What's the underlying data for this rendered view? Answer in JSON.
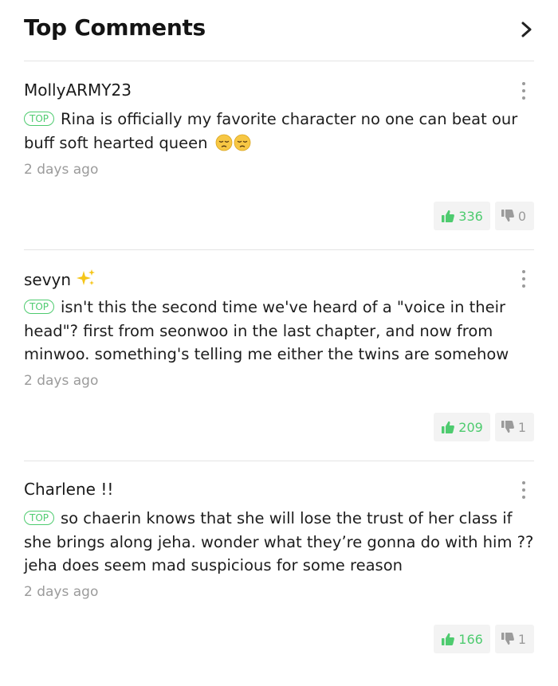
{
  "header": {
    "title": "Top Comments",
    "chevron_icon": "chevron-right-icon"
  },
  "badge_label": "TOP",
  "colors": {
    "accent_green": "#4ecb6f",
    "muted_gray": "#9b9b9b",
    "divider": "#e4e4e4"
  },
  "comments": [
    {
      "username": "MollyARMY23",
      "text": "Rina is officially my favorite character no one can beat our buff soft hearted queen",
      "emojis": [
        "pensive-face-emoji",
        "pensive-face-emoji"
      ],
      "time": "2 days ago",
      "likes": "336",
      "dislikes": "0"
    },
    {
      "username": "sevyn",
      "username_icon": "sparkles-emoji",
      "text": "isn't this the second time we've heard of a \"voice in their head\"? first from seonwoo in the last chapter, and now from minwoo. something's telling me either the twins are somehow",
      "time": "2 days ago",
      "likes": "209",
      "dislikes": "1"
    },
    {
      "username": "Charlene !!",
      "text": "so chaerin knows that she will lose the trust of her class if she brings along jeha. wonder what they’re gonna do with him ?? jeha does seem mad suspicious for some reason",
      "time": "2 days ago",
      "likes": "166",
      "dislikes": "1"
    }
  ]
}
